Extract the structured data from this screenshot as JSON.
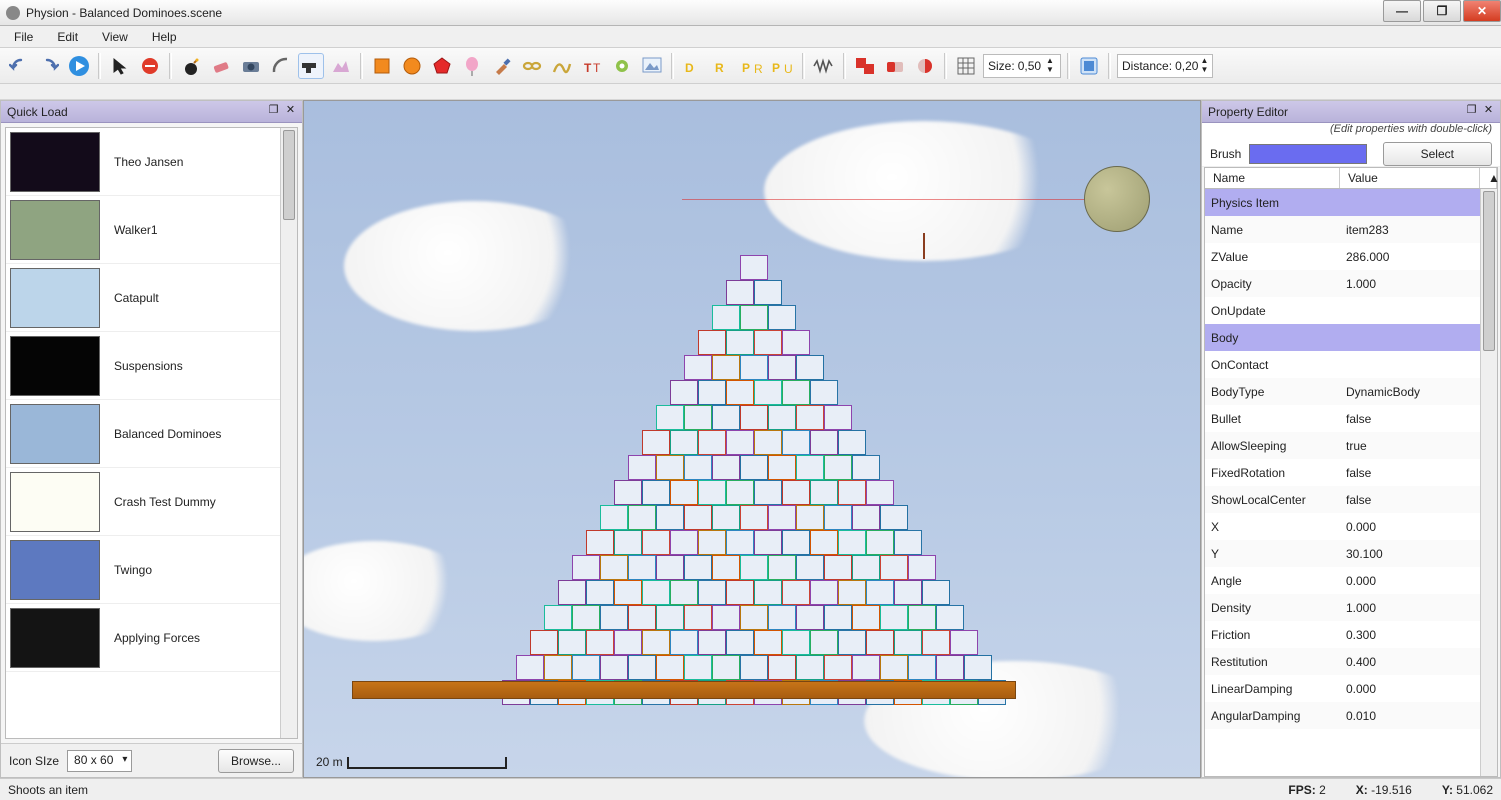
{
  "window": {
    "title": "Physion - Balanced Dominoes.scene"
  },
  "menu": {
    "file": "File",
    "edit": "Edit",
    "view": "View",
    "help": "Help"
  },
  "toolbar": {
    "size_label": "Size:",
    "size_value": "0,50",
    "distance_label": "Distance:",
    "distance_value": "0,20"
  },
  "quickLoad": {
    "title": "Quick Load",
    "items": [
      {
        "label": "Theo Jansen",
        "bg": "#130b1a"
      },
      {
        "label": "Walker1",
        "bg": "#8fa481"
      },
      {
        "label": "Catapult",
        "bg": "#bcd5ea"
      },
      {
        "label": "Suspensions",
        "bg": "#050505"
      },
      {
        "label": "Balanced Dominoes",
        "bg": "#9ab7d8"
      },
      {
        "label": "Crash Test Dummy",
        "bg": "#fdfdf4"
      },
      {
        "label": "Twingo",
        "bg": "#5d79c0"
      },
      {
        "label": "Applying Forces",
        "bg": "#141414"
      }
    ],
    "iconSizeLabel": "Icon SIze",
    "iconSizeValue": "80 x 60",
    "browse": "Browse..."
  },
  "canvas": {
    "scaleLabel": "20 m"
  },
  "propertyEditor": {
    "title": "Property Editor",
    "hint": "(Edit properties with double-click)",
    "brushLabel": "Brush",
    "brushColor": "#6a6cf0",
    "selectLabel": "Select",
    "colName": "Name",
    "colValue": "Value",
    "rows": [
      {
        "section": true,
        "name": "Physics Item",
        "value": ""
      },
      {
        "section": false,
        "name": "Name",
        "value": "item283"
      },
      {
        "section": false,
        "name": "ZValue",
        "value": "286.000"
      },
      {
        "section": false,
        "name": "Opacity",
        "value": "1.000"
      },
      {
        "section": false,
        "name": "OnUpdate",
        "value": ""
      },
      {
        "section": true,
        "name": "Body",
        "value": ""
      },
      {
        "section": false,
        "name": "OnContact",
        "value": ""
      },
      {
        "section": false,
        "name": "BodyType",
        "value": "DynamicBody"
      },
      {
        "section": false,
        "name": "Bullet",
        "value": "false"
      },
      {
        "section": false,
        "name": "AllowSleeping",
        "value": "true"
      },
      {
        "section": false,
        "name": "FixedRotation",
        "value": "false"
      },
      {
        "section": false,
        "name": "ShowLocalCenter",
        "value": "false"
      },
      {
        "section": false,
        "name": "X",
        "value": "0.000"
      },
      {
        "section": false,
        "name": "Y",
        "value": "30.100"
      },
      {
        "section": false,
        "name": "Angle",
        "value": "0.000"
      },
      {
        "section": false,
        "name": "Density",
        "value": "1.000"
      },
      {
        "section": false,
        "name": "Friction",
        "value": "0.300"
      },
      {
        "section": false,
        "name": "Restitution",
        "value": "0.400"
      },
      {
        "section": false,
        "name": "LinearDamping",
        "value": "0.000"
      },
      {
        "section": false,
        "name": "AngularDamping",
        "value": "0.010"
      }
    ]
  },
  "status": {
    "hint": "Shoots an item",
    "fpsLabel": "FPS:",
    "fpsValue": "2",
    "xLabel": "X:",
    "xValue": "-19.516",
    "yLabel": "Y:",
    "yValue": "51.062"
  }
}
